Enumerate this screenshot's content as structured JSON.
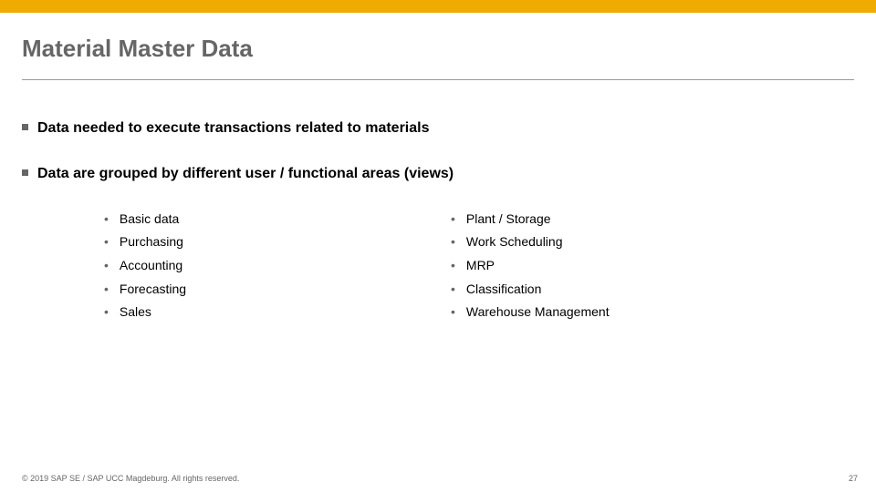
{
  "title": "Material Master Data",
  "bullets": [
    {
      "text": "Data needed to execute transactions related to materials"
    },
    {
      "text": "Data are grouped by different user / functional areas (views)"
    }
  ],
  "subLeft": [
    "Basic data",
    "Purchasing",
    "Accounting",
    "Forecasting",
    "Sales"
  ],
  "subRight": [
    "Plant / Storage",
    "Work Scheduling",
    "MRP",
    "Classification",
    "Warehouse Management"
  ],
  "footer": {
    "copyright": "© 2019 SAP SE / SAP UCC Magdeburg. All rights reserved.",
    "page": "27"
  }
}
